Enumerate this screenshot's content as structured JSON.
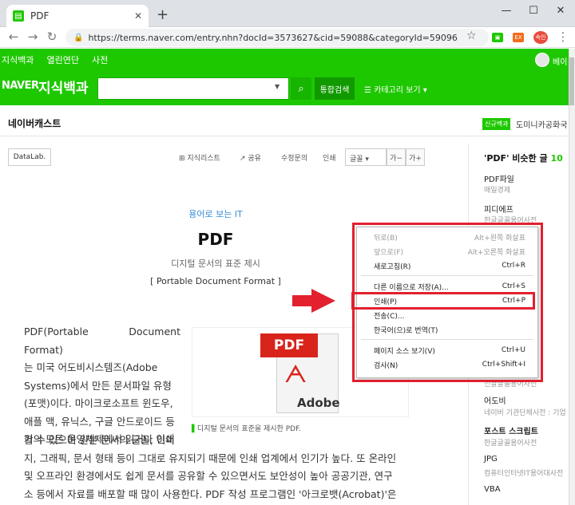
{
  "browser": {
    "tab_title": "PDF",
    "tab_close": "✕",
    "new_tab": "+",
    "url": "https://terms.naver.com/entry.nhn?docId=3573627&cid=59088&categoryId=59096",
    "ext_badge": "EX",
    "profile_label": "속인"
  },
  "gnb": {
    "items": [
      "지식백과",
      "열린연단",
      "사전"
    ],
    "user_label": "베이"
  },
  "search": {
    "logo_brand": "NAVER",
    "logo_service": "지식백과",
    "total_search": "통합검색",
    "category_view": "카테고리 보기"
  },
  "page": {
    "title": "네이버캐스트",
    "new_badge": "신규백과",
    "new_text": "도미니카공화국",
    "datalab": "DataLab.",
    "tools": [
      "지식리스트",
      "공유",
      "수정문의",
      "인쇄"
    ],
    "font_select": "글꼴",
    "font_minus": "가−",
    "font_plus": "가+"
  },
  "article": {
    "category": "용어로 보는 IT",
    "title": "PDF",
    "subtitle": "디지털 문서의 표준 제시",
    "english": "[ Portable Document Format ]",
    "para_lines": [
      "PDF(Portable Document Format)",
      "는 미국 어도비시스템즈(Adobe",
      "Systems)에서 만든 문서파일 유형",
      "(포맷)이다. 마이크로소프트 윈도우,",
      "애플 맥, 유닉스, 구글 안드로이드 등",
      "거의 모든 운영체제에서 읽거나 인쇄"
    ],
    "para2_lines": [
      "할 수 있으며 원본 문서의 글꼴, 이미",
      "지, 그래픽, 문서 형태 등이 그대로 유지되기 때문에 인쇄 업계에서 인기가 높다. 또 온라인",
      "및 오프라인 환경에서도 쉽게 문서를 공유할 수 있으면서도 보안성이 높아 공공기관, 연구",
      "소 등에서 자료를 배포할 때 많이 사용한다. PDF 작성 프로그램인 '아크로뱃(Acrobat)'은"
    ],
    "image_pdf_label": "PDF",
    "image_brand": "Adobe",
    "caption": "디지털 문서의 표준을 제시한 PDF."
  },
  "sidebar": {
    "heading": "'PDF' 비슷한 글",
    "count": "10",
    "items": [
      {
        "title": "PDF파일",
        "source": "매일경제"
      },
      {
        "title": "피디에프",
        "source": "한글글꼴용어사전"
      },
      {
        "title": "어도비",
        "source": "네이버 기관단체사전 : 기업"
      },
      {
        "title": "포스트 스크립트",
        "source": "한글글꼴용어사전"
      },
      {
        "title": "JPG",
        "source": "컴퓨터인터넷IT용어대사전"
      },
      {
        "title": "VBA",
        "source": ""
      }
    ],
    "partial": "인글글꼴용어사전"
  },
  "context_menu": {
    "items": [
      {
        "label": "뒤로(B)",
        "shortcut": "Alt+왼쪽 화살표",
        "disabled": true
      },
      {
        "label": "앞으로(F)",
        "shortcut": "Alt+오른쪽 화살표",
        "disabled": true
      },
      {
        "label": "새로고침(R)",
        "shortcut": "Ctrl+R",
        "disabled": false
      },
      {
        "label": "다른 이름으로 저장(A)...",
        "shortcut": "Ctrl+S",
        "disabled": false
      },
      {
        "label": "인쇄(P)",
        "shortcut": "Ctrl+P",
        "disabled": false
      },
      {
        "label": "전송(C)...",
        "shortcut": "",
        "disabled": false
      },
      {
        "label": "한국어(으)로 번역(T)",
        "shortcut": "",
        "disabled": false
      },
      {
        "label": "페이지 소스 보기(V)",
        "shortcut": "Ctrl+U",
        "disabled": false
      },
      {
        "label": "검사(N)",
        "shortcut": "Ctrl+Shift+I",
        "disabled": false
      }
    ]
  },
  "colors": {
    "naver_green": "#1ec800",
    "highlight_red": "#e3202e",
    "link_blue": "#3a6fc6"
  }
}
